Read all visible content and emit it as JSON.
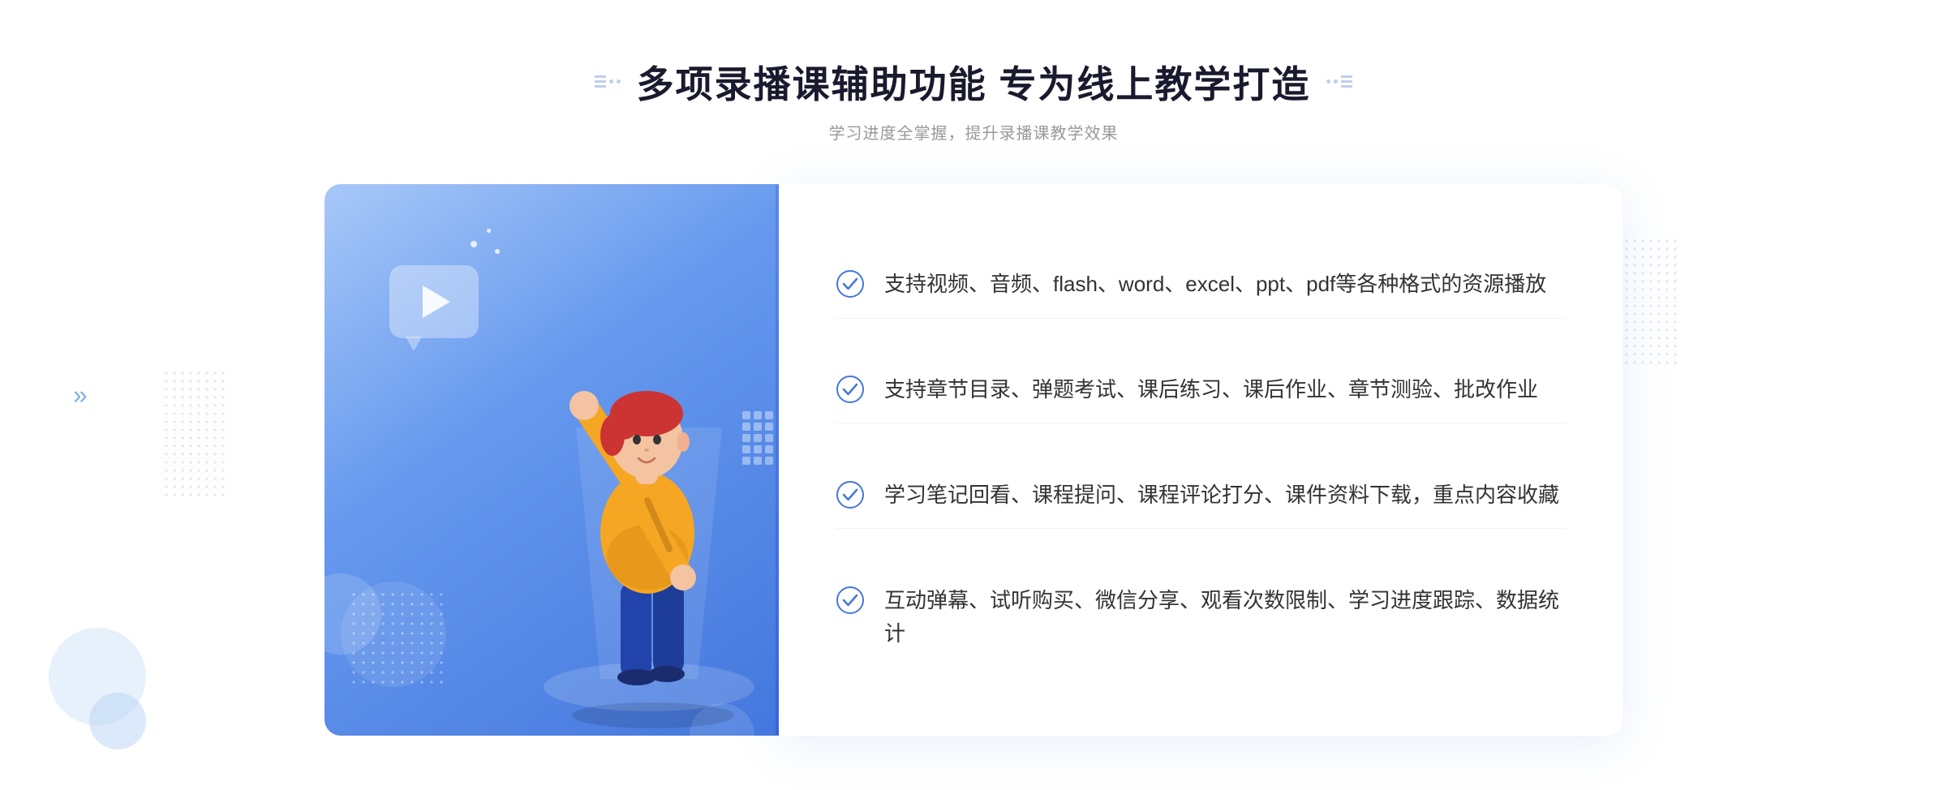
{
  "header": {
    "title": "多项录播课辅助功能 专为线上教学打造",
    "subtitle": "学习进度全掌握，提升录播课教学效果"
  },
  "features": [
    {
      "id": 1,
      "text": "支持视频、音频、flash、word、excel、ppt、pdf等各种格式的资源播放"
    },
    {
      "id": 2,
      "text": "支持章节目录、弹题考试、课后练习、课后作业、章节测验、批改作业"
    },
    {
      "id": 3,
      "text": "学习笔记回看、课程提问、课程评论打分、课件资料下载，重点内容收藏"
    },
    {
      "id": 4,
      "text": "互动弹幕、试听购买、微信分享、观看次数限制、学习进度跟踪、数据统计"
    }
  ],
  "icons": {
    "check": "check-circle-icon",
    "play": "play-icon",
    "arrow_left": "chevron-double-left-icon"
  },
  "colors": {
    "accent_blue": "#4477dd",
    "light_blue": "#a8c8f8",
    "text_dark": "#1a1a2e",
    "text_gray": "#999999",
    "text_body": "#333333"
  }
}
